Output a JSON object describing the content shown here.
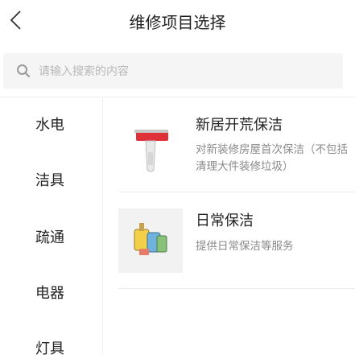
{
  "header": {
    "title": "维修项目选择",
    "back_icon": "chevron-left-icon"
  },
  "search": {
    "placeholder": "请输入搜索的内容",
    "icon": "search-icon"
  },
  "sidebar": {
    "items": [
      {
        "label": "水电"
      },
      {
        "label": "洁具"
      },
      {
        "label": "疏通"
      },
      {
        "label": "电器"
      },
      {
        "label": "灯具"
      }
    ]
  },
  "services": [
    {
      "name": "新居开荒保洁",
      "desc": "对新装修房屋首次保洁（不包括清理大件装修垃圾）",
      "image": "scraper-image"
    },
    {
      "name": "日常保洁",
      "desc": "提供日常保洁等服务",
      "image": "cleaning-supplies-image"
    }
  ],
  "colors": {
    "accent": "#e0303a",
    "text": "#222222",
    "muted": "#8a8a8a",
    "search_bg": "#f5f5f5"
  }
}
